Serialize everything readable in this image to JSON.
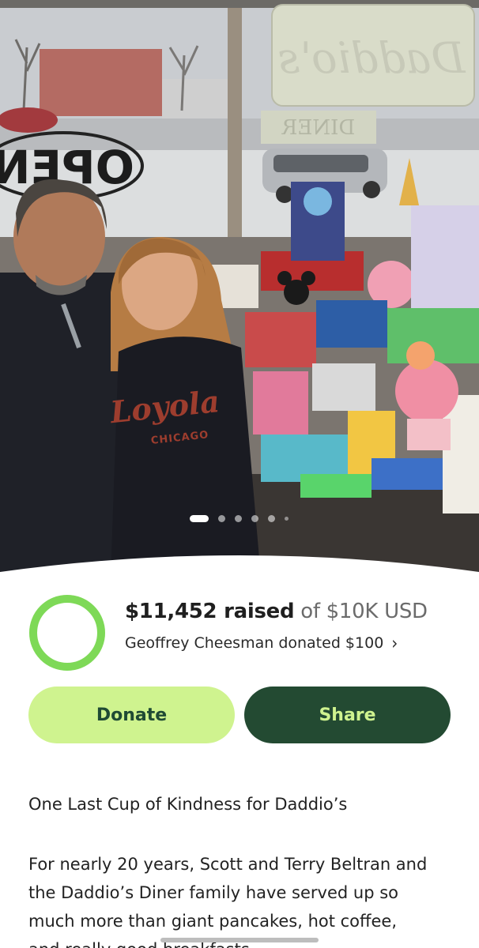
{
  "hero": {
    "window_text_open": "OPEN",
    "sign_text_top": "Daddio's",
    "sign_text_bottom": "DINER",
    "shirt_text": "Loyola",
    "shirt_subtext": "CHICAGO",
    "carousel": {
      "total": 6,
      "active": 1
    }
  },
  "fundraiser": {
    "raised_amount": "$11,452 raised",
    "goal_text": "of $10K USD",
    "progress_fraction": 1.0,
    "recent_donation": "Geoffrey Cheesman donated $100",
    "colors": {
      "ring": "#7ed957",
      "donate_bg": "#cff38f",
      "donate_text": "#1f4a34",
      "share_bg": "#234a32",
      "share_text": "#cff38f"
    }
  },
  "actions": {
    "donate_label": "Donate",
    "share_label": "Share"
  },
  "story": {
    "title": "One Last Cup of Kindness for Daddio’s",
    "lines": [
      "For nearly 20 years, Scott and Terry Beltran and",
      "the Daddio’s Diner family have served up so",
      "much more than giant pancakes, hot coffee,",
      "and really good breakfasts."
    ]
  },
  "icons": {
    "chevron": "chevron-right-icon",
    "progress": "progress-ring-icon"
  }
}
